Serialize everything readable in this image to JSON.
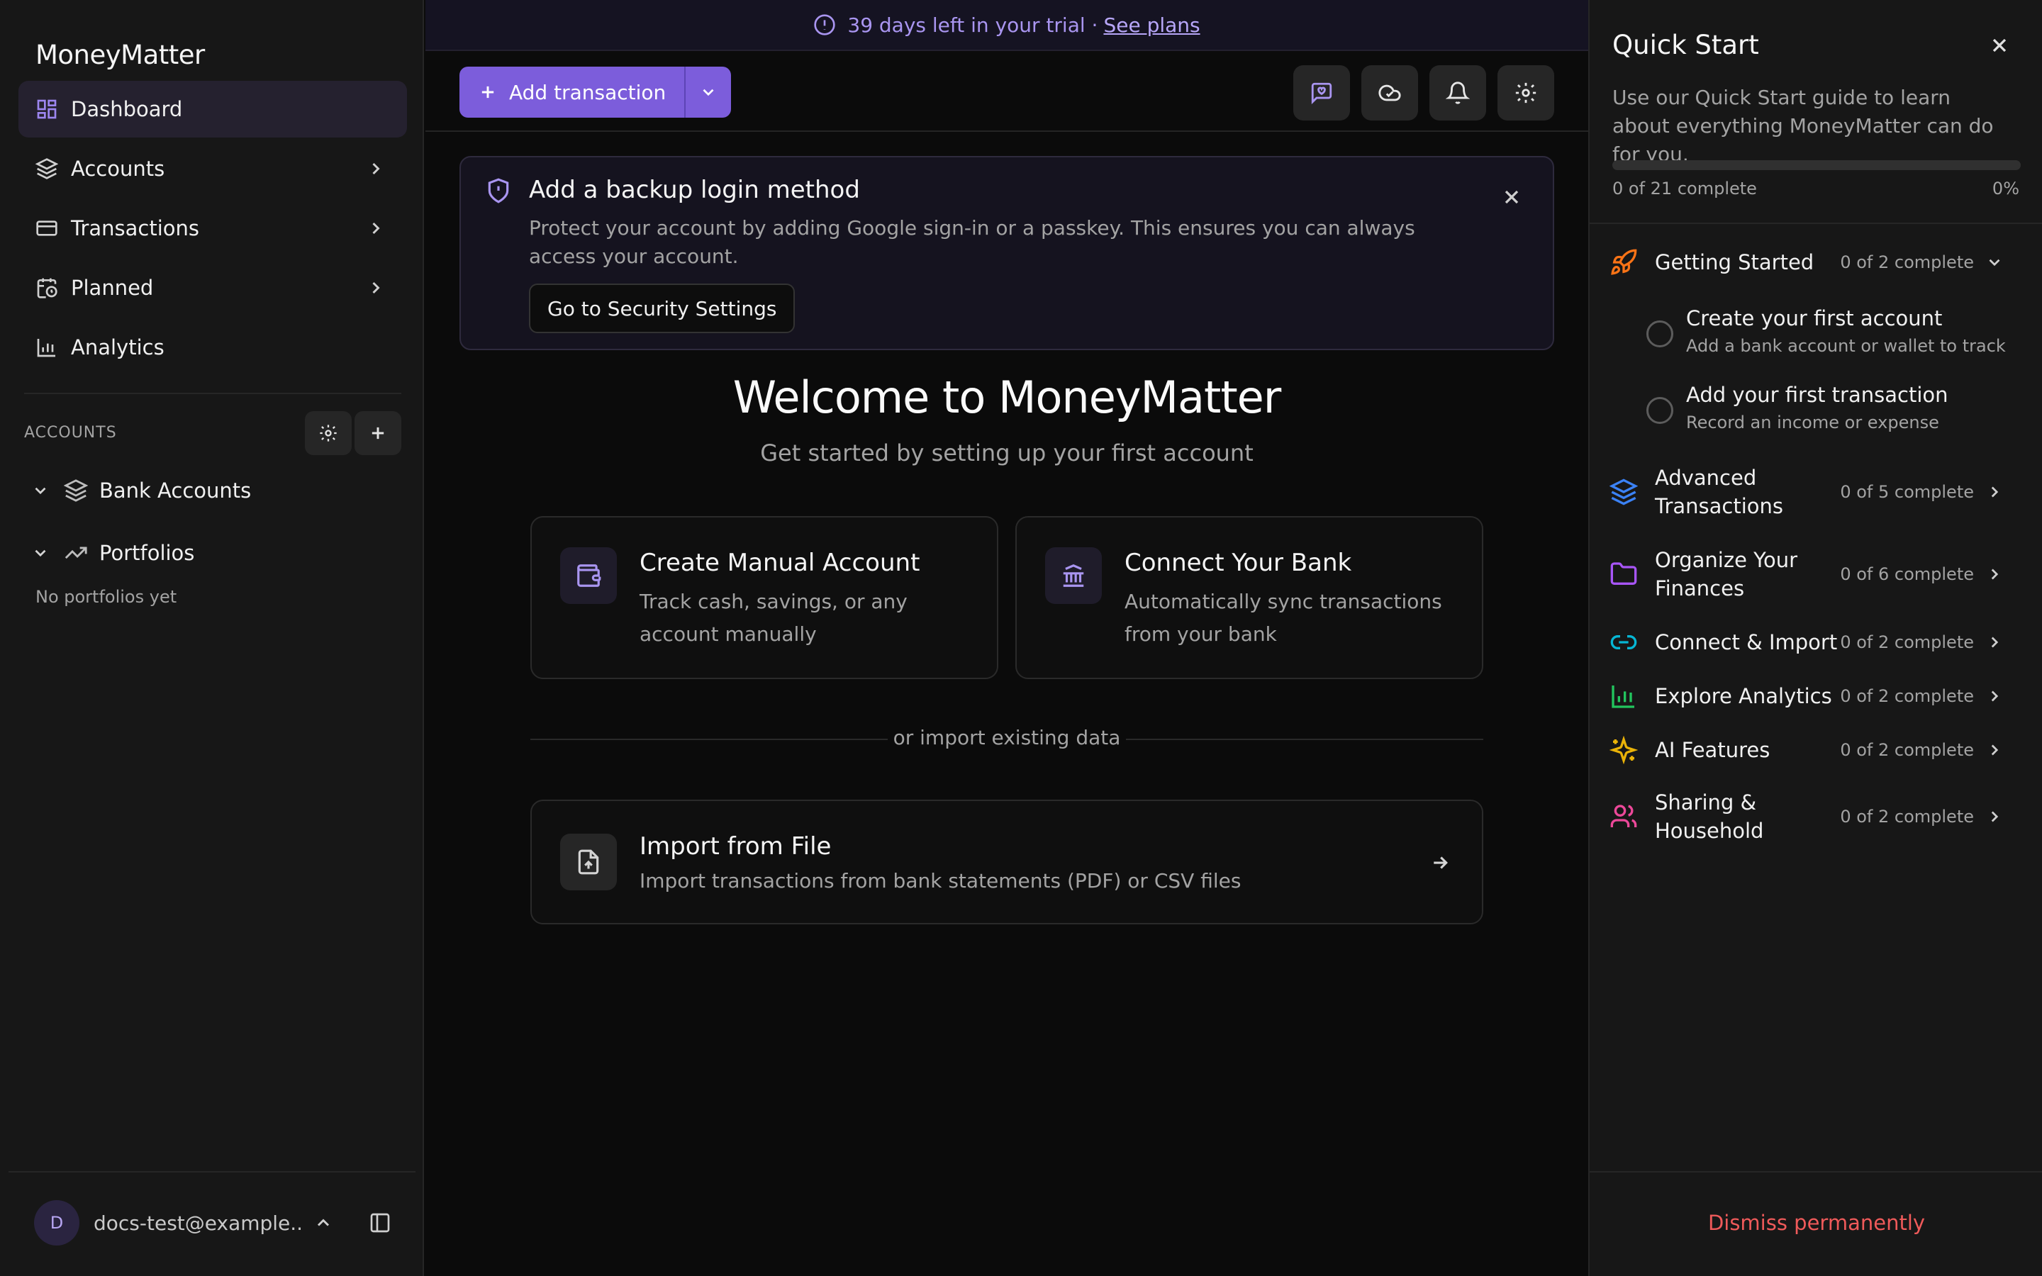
{
  "sidebar": {
    "app_title": "MoneyMatter",
    "nav": [
      {
        "label": "Dashboard"
      },
      {
        "label": "Accounts"
      },
      {
        "label": "Transactions"
      },
      {
        "label": "Planned"
      },
      {
        "label": "Analytics"
      }
    ],
    "accounts_section_label": "ACCOUNTS",
    "groups": [
      {
        "label": "Bank Accounts"
      },
      {
        "label": "Portfolios"
      }
    ],
    "portfolios_empty": "No portfolios yet",
    "user": {
      "avatar_initial": "D",
      "email": "docs-test@example...."
    }
  },
  "banner": {
    "text": "39 days left in your trial ·",
    "link": "See plans"
  },
  "toolbar": {
    "add_transaction_label": "Add transaction"
  },
  "security_card": {
    "title": "Add a backup login method",
    "description": "Protect your account by adding Google sign-in or a passkey. This ensures you can always access your account.",
    "button": "Go to Security Settings"
  },
  "welcome": {
    "title": "Welcome to MoneyMatter",
    "subtitle": "Get started by setting up your first account"
  },
  "options": [
    {
      "title": "Create Manual Account",
      "description": "Track cash, savings, or any account manually"
    },
    {
      "title": "Connect Your Bank",
      "description": "Automatically sync transactions from your bank"
    }
  ],
  "divider_text": "or import existing data",
  "import": {
    "title": "Import from File",
    "description": "Import transactions from bank statements (PDF) or CSV files"
  },
  "quick_start": {
    "title": "Quick Start",
    "intro": "Use our Quick Start guide to learn about everything MoneyMatter can do for you.",
    "progress_text": "0 of 21 complete",
    "progress_percent": "0%",
    "progress_fraction": 0,
    "sections": [
      {
        "label": "Getting Started",
        "count": "0 of 2 complete",
        "color": "#f97316"
      },
      {
        "label": "Advanced Transactions",
        "count": "0 of 5 complete",
        "color": "#3b82f6"
      },
      {
        "label": "Organize Your Finances",
        "count": "0 of 6 complete",
        "color": "#a855f7"
      },
      {
        "label": "Connect & Import",
        "count": "0 of 2 complete",
        "color": "#06b6d4"
      },
      {
        "label": "Explore Analytics",
        "count": "0 of 2 complete",
        "color": "#22c55e"
      },
      {
        "label": "AI Features",
        "count": "0 of 2 complete",
        "color": "#eab308"
      },
      {
        "label": "Sharing & Household",
        "count": "0 of 2 complete",
        "color": "#ec4899"
      }
    ],
    "tasks": [
      {
        "title": "Create your first account",
        "subtitle": "Add a bank account or wallet to track"
      },
      {
        "title": "Add your first transaction",
        "subtitle": "Record an income or expense"
      }
    ],
    "dismiss": "Dismiss permanently"
  },
  "colors": {
    "accent": "#7c5ddb",
    "accent_light": "#a995f0",
    "danger": "#ef5a5a"
  }
}
